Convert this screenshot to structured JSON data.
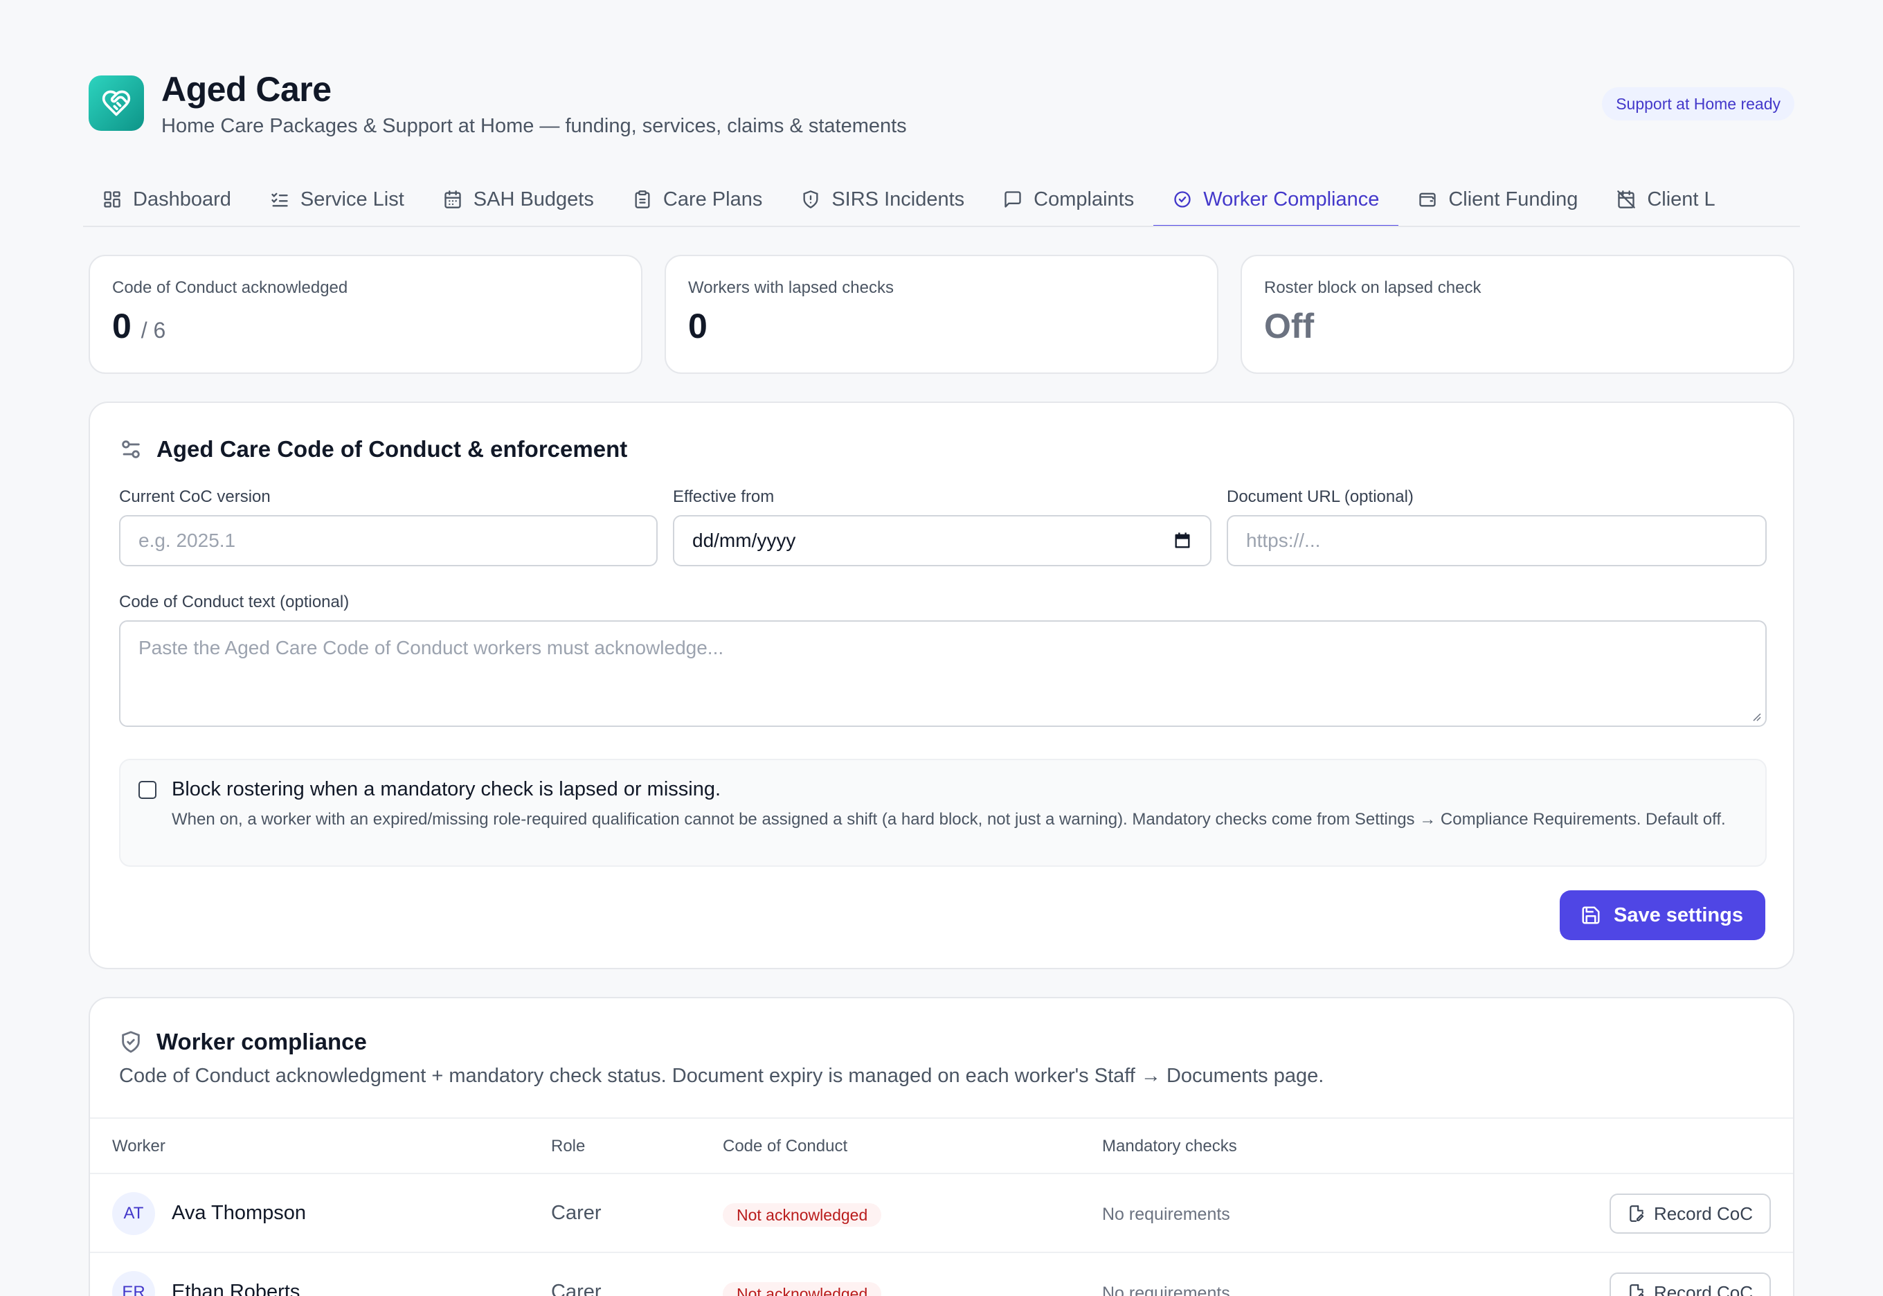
{
  "header": {
    "title": "Aged Care",
    "subtitle": "Home Care Packages & Support at Home — funding, services, claims & statements",
    "badge": "Support at Home ready",
    "logo_icon": "heart-handshake-icon",
    "brand_color": "#14b8a6"
  },
  "tabs": [
    {
      "label": "Dashboard",
      "icon": "dashboard-icon"
    },
    {
      "label": "Service List",
      "icon": "list-check-icon"
    },
    {
      "label": "SAH Budgets",
      "icon": "calendar-icon"
    },
    {
      "label": "Care Plans",
      "icon": "clipboard-icon"
    },
    {
      "label": "SIRS Incidents",
      "icon": "shield-alert-icon"
    },
    {
      "label": "Complaints",
      "icon": "message-square-icon"
    },
    {
      "label": "Worker Compliance",
      "icon": "check-circle-icon",
      "active": true
    },
    {
      "label": "Client Funding",
      "icon": "wallet-icon"
    },
    {
      "label": "Client L",
      "icon": "calendar-off-icon"
    }
  ],
  "stats": [
    {
      "label": "Code of Conduct acknowledged",
      "value": "0",
      "denominator": "/ 6"
    },
    {
      "label": "Workers with lapsed checks",
      "value": "0"
    },
    {
      "label": "Roster block on lapsed check",
      "value": "Off"
    }
  ],
  "settings": {
    "title": "Aged Care Code of Conduct & enforcement",
    "coc_version_label": "Current CoC version",
    "coc_version_placeholder": "e.g. 2025.1",
    "effective_from_label": "Effective from",
    "effective_from_value": "dd/mm/yyyy",
    "doc_url_label": "Document URL (optional)",
    "doc_url_placeholder": "https://...",
    "coc_text_label": "Code of Conduct text (optional)",
    "coc_text_placeholder": "Paste the Aged Care Code of Conduct workers must acknowledge...",
    "block_title": "Block rostering when a mandatory check is lapsed or missing.",
    "block_desc": "When on, a worker with an expired/missing role-required qualification cannot be assigned a shift (a hard block, not just a warning). Mandatory checks come from Settings → Compliance Requirements. Default off.",
    "save_label": "Save settings",
    "primary_color": "#4f46e5"
  },
  "workers": {
    "title": "Worker compliance",
    "subtitle": "Code of Conduct acknowledgment + mandatory check status. Document expiry is managed on each worker's Staff → Documents page.",
    "columns": [
      "Worker",
      "Role",
      "Code of Conduct",
      "Mandatory checks"
    ],
    "rows": [
      {
        "initials": "AT",
        "name": "Ava Thompson",
        "role": "Carer",
        "coc": "Not acknowledged",
        "checks": "No requirements",
        "action": "Record CoC"
      },
      {
        "initials": "ER",
        "name": "Ethan Roberts",
        "role": "Carer",
        "coc": "Not acknowledged",
        "checks": "No requirements",
        "action": "Record CoC"
      }
    ]
  }
}
